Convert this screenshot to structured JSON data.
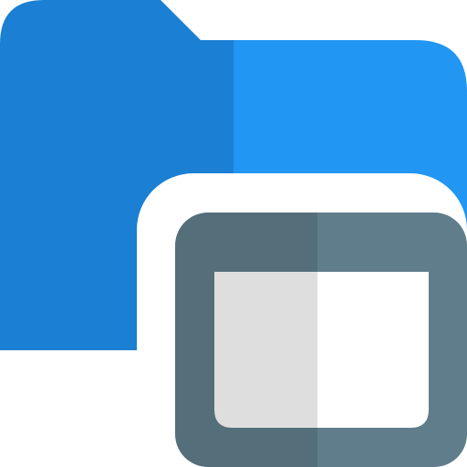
{
  "icon": {
    "name": "folder-window-icon",
    "colors": {
      "folder_left": "#1b7fd3",
      "folder_right": "#2196f3",
      "window_frame_left": "#546e7a",
      "window_frame_right": "#607d8b",
      "window_pane_left": "#dedede",
      "window_pane_right": "#ffffff",
      "background": "#ffffff"
    }
  }
}
